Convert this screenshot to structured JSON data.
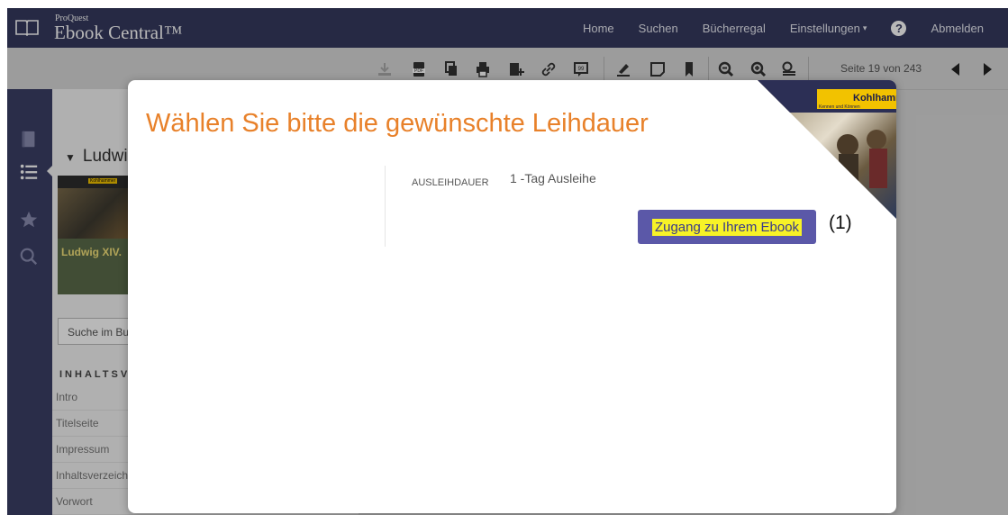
{
  "header": {
    "brand_small": "ProQuest",
    "brand_big": "Ebook Central™",
    "nav": {
      "home": "Home",
      "search": "Suchen",
      "bookshelf": "Bücherregal",
      "settings": "Einstellungen",
      "logout": "Abmelden"
    }
  },
  "toolbar": {
    "page_info": "Seite 19 von 243"
  },
  "panel": {
    "book_title": "Ludwig",
    "cover_publisher": "Kohlhammer",
    "cover_title": "Ludwig XIV.",
    "search_placeholder": "Suche im Bu",
    "toc_heading": "INHALTSVE",
    "toc_items": [
      "Intro",
      "Titelseite",
      "Impressum",
      "Inhaltsverzeich",
      "Vorwort"
    ]
  },
  "modal": {
    "title": "Wählen Sie bitte die gewünschte Leihdauer",
    "loan_label": "AUSLEIHDAUER",
    "loan_value": "1 -Tag Ausleihe",
    "access_button": "Zugang zu Ihrem Ebook",
    "marker": "(1)",
    "corner_publisher": "Kohlhammer",
    "corner_tagline": "Kennen und Können"
  },
  "colors": {
    "nav_bg": "#353a5f",
    "rail_bg": "#3b3f66",
    "title_orange": "#e8812a",
    "button_bg": "#5b58a8",
    "highlight": "#f7f227"
  }
}
